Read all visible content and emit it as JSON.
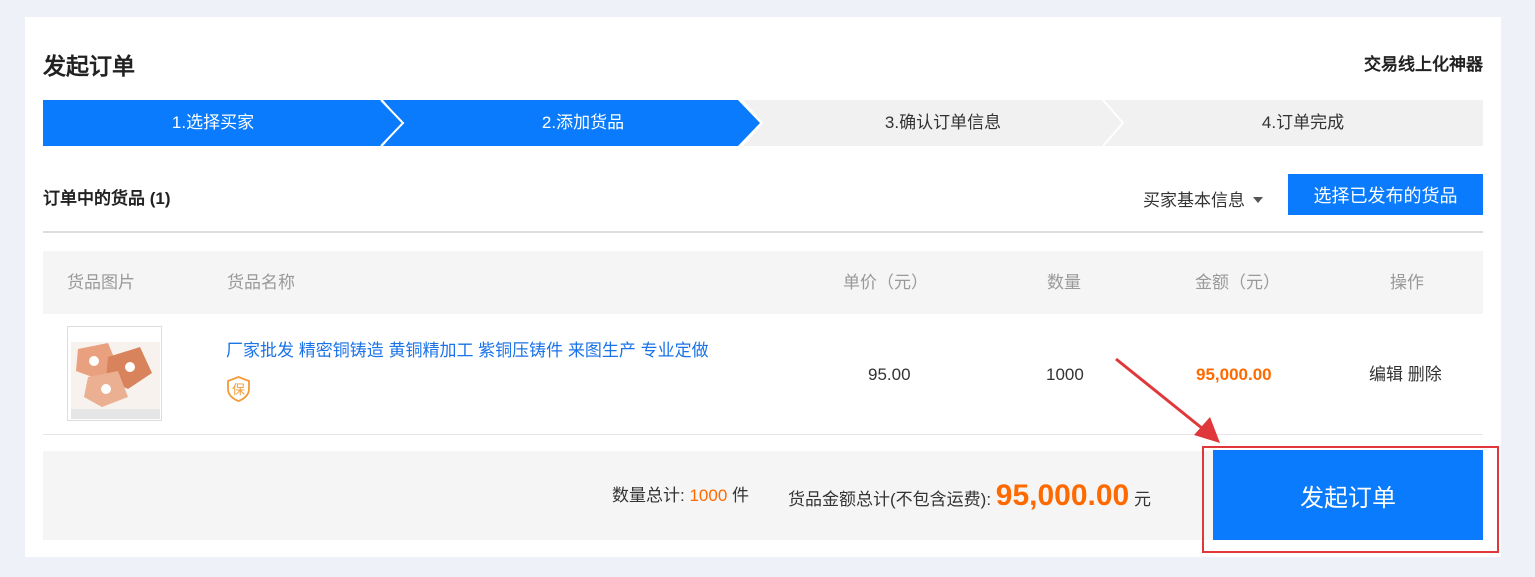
{
  "header": {
    "title": "发起订单",
    "slogan": "交易线上化神器"
  },
  "steps": [
    {
      "label": "1.选择买家",
      "active": true
    },
    {
      "label": "2.添加货品",
      "active": true
    },
    {
      "label": "3.确认订单信息",
      "active": false
    },
    {
      "label": "4.订单完成",
      "active": false
    }
  ],
  "goods": {
    "section_title": "订单中的货品 (1)",
    "buyer_info_label": "买家基本信息",
    "select_button": "选择已发布的货品"
  },
  "table": {
    "columns": [
      "货品图片",
      "货品名称",
      "单价（元）",
      "数量",
      "金额（元）",
      "操作"
    ],
    "rows": [
      {
        "image_alt": "铜铸件工厂",
        "name": "厂家批发 精密铜铸造 黄铜精加工 紫铜压铸件 来图生产 专业定做",
        "badge": "保",
        "price": "95.00",
        "quantity": "1000",
        "amount": "95,000.00",
        "edit": "编辑",
        "delete": "删除"
      }
    ]
  },
  "summary": {
    "qty_label": "数量总计:",
    "qty_value": "1000",
    "qty_unit": "件",
    "amount_label": "货品金额总计(不包含运费):",
    "amount_value": "95,000.00",
    "amount_unit": "元"
  },
  "submit_button": "发起订单",
  "colors": {
    "primary": "#0a7bfc",
    "accent": "#ff6a00",
    "highlight": "#e0383a"
  }
}
